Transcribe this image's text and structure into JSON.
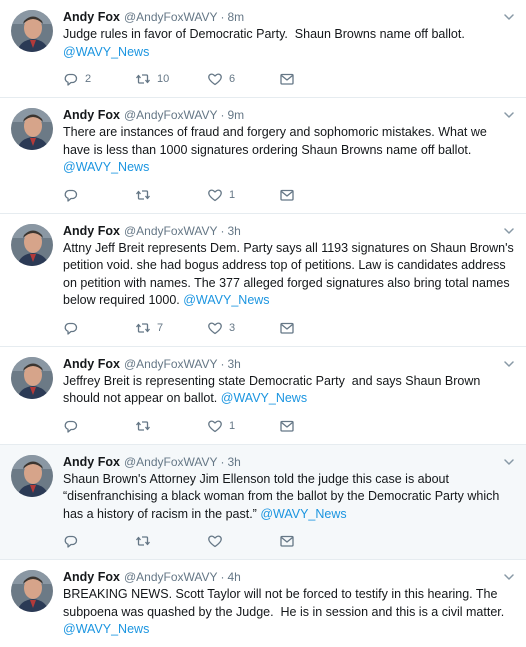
{
  "tweets": [
    {
      "name": "Andy Fox",
      "handle": "@AndyFoxWAVY",
      "time": "8m",
      "text": "Judge rules in favor of Democratic Party.  Shaun Browns name off ballot. ",
      "link": "@WAVY_News",
      "replies": "2",
      "retweets": "10",
      "likes": "6",
      "highlight": false
    },
    {
      "name": "Andy Fox",
      "handle": "@AndyFoxWAVY",
      "time": "9m",
      "text": "There are instances of fraud and forgery and sophomoric mistakes. What we have is less than 1000 signatures ordering Shaun Browns name off ballot. ",
      "link": "@WAVY_News",
      "replies": "",
      "retweets": "",
      "likes": "1",
      "highlight": false
    },
    {
      "name": "Andy Fox",
      "handle": "@AndyFoxWAVY",
      "time": "3h",
      "text": "Attny Jeff Breit represents Dem. Party says all 1193 signatures on Shaun Brown's petition void. she had bogus address top of petitions. Law is candidates address on petition with names. The 377 alleged forged signatures also bring total names below required 1000. ",
      "link": "@WAVY_News",
      "replies": "",
      "retweets": "7",
      "likes": "3",
      "highlight": false
    },
    {
      "name": "Andy Fox",
      "handle": "@AndyFoxWAVY",
      "time": "3h",
      "text": "Jeffrey Breit is representing state Democratic Party  and says Shaun Brown should not appear on ballot. ",
      "link": "@WAVY_News",
      "replies": "",
      "retweets": "",
      "likes": "1",
      "highlight": false
    },
    {
      "name": "Andy Fox",
      "handle": "@AndyFoxWAVY",
      "time": "3h",
      "text": "Shaun Brown's Attorney Jim Ellenson told the judge this case is about “disenfranchising a black woman from the ballot by the Democratic Party which has a history of racism in the past.” ",
      "link": "@WAVY_News",
      "replies": "",
      "retweets": "",
      "likes": "",
      "highlight": true
    },
    {
      "name": "Andy Fox",
      "handle": "@AndyFoxWAVY",
      "time": "4h",
      "text": "BREAKING NEWS. Scott Taylor will not be forced to testify in this hearing. The subpoena was quashed by the Judge.  He is in session and this is a civil matter. ",
      "link": "@WAVY_News",
      "replies": "",
      "retweets": "",
      "likes": "",
      "highlight": false
    }
  ],
  "icons": {
    "reply": "reply-icon",
    "retweet": "retweet-icon",
    "like": "heart-icon",
    "dm": "envelope-icon",
    "menu": "chevron-down-icon"
  },
  "colors": {
    "link": "#1b95e0",
    "muted": "#657786",
    "divider": "#e6ecf0",
    "highlight_bg": "#f5f8fa"
  }
}
